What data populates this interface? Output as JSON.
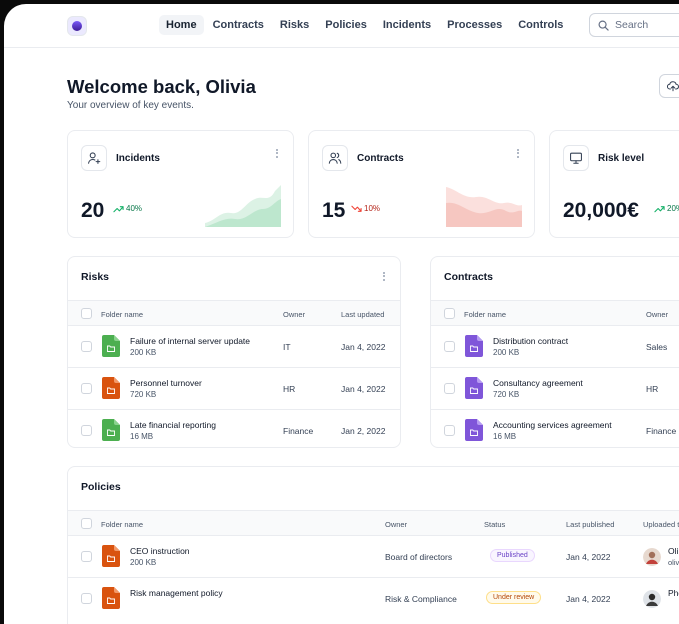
{
  "nav": {
    "items": [
      "Home",
      "Contracts",
      "Risks",
      "Policies",
      "Incidents",
      "Processes",
      "Controls"
    ],
    "active": "Home",
    "search_placeholder": "Search"
  },
  "header": {
    "title": "Welcome back, Olivia",
    "subtitle": "Your overview of key events."
  },
  "stats": [
    {
      "title": "Incidents",
      "value": "20",
      "trend": "40%",
      "direction": "up",
      "icon": "user-plus-icon",
      "accent": "#16b364"
    },
    {
      "title": "Contracts",
      "value": "15",
      "trend": "10%",
      "direction": "down",
      "icon": "users-icon",
      "accent": "#f04438"
    },
    {
      "title": "Risk level",
      "value": "20,000€",
      "trend": "20%",
      "direction": "up",
      "icon": "monitor-icon",
      "accent": "#16b364"
    }
  ],
  "risks": {
    "title": "Risks",
    "columns": [
      "Folder name",
      "Owner",
      "Last updated"
    ],
    "rows": [
      {
        "name": "Failure of internal server update",
        "size": "200 KB",
        "owner": "IT",
        "date": "Jan 4, 2022",
        "color": "#4caf50"
      },
      {
        "name": "Personnel turnover",
        "size": "720 KB",
        "owner": "HR",
        "date": "Jan 4, 2022",
        "color": "#d9530f"
      },
      {
        "name": "Late financial reporting",
        "size": "16 MB",
        "owner": "Finance",
        "date": "Jan 2, 2022",
        "color": "#4caf50"
      }
    ]
  },
  "contracts": {
    "title": "Contracts",
    "columns": [
      "Folder name",
      "Owner"
    ],
    "rows": [
      {
        "name": "Distribution contract",
        "size": "200 KB",
        "owner": "Sales",
        "color": "#7f56d9"
      },
      {
        "name": "Consultancy agreement",
        "size": "720 KB",
        "owner": "HR",
        "color": "#7f56d9"
      },
      {
        "name": "Accounting services agreement",
        "size": "16 MB",
        "owner": "Finance",
        "color": "#7f56d9"
      }
    ]
  },
  "policies": {
    "title": "Policies",
    "columns": [
      "Folder name",
      "Owner",
      "Status",
      "Last published",
      "Uploaded t"
    ],
    "rows": [
      {
        "name": "CEO instruction",
        "size": "200 KB",
        "owner": "Board of directors",
        "status": "Published",
        "status_kind": "published",
        "date": "Jan 4, 2022",
        "uploader": "Oli",
        "uploader_sub": "oliv",
        "color": "#d9530f"
      },
      {
        "name": "Risk management policy",
        "size": "",
        "owner": "Risk & Compliance",
        "status": "Under review",
        "status_kind": "review",
        "date": "Jan 4, 2022",
        "uploader": "Phe",
        "uploader_sub": "",
        "color": "#d9530f"
      }
    ]
  }
}
